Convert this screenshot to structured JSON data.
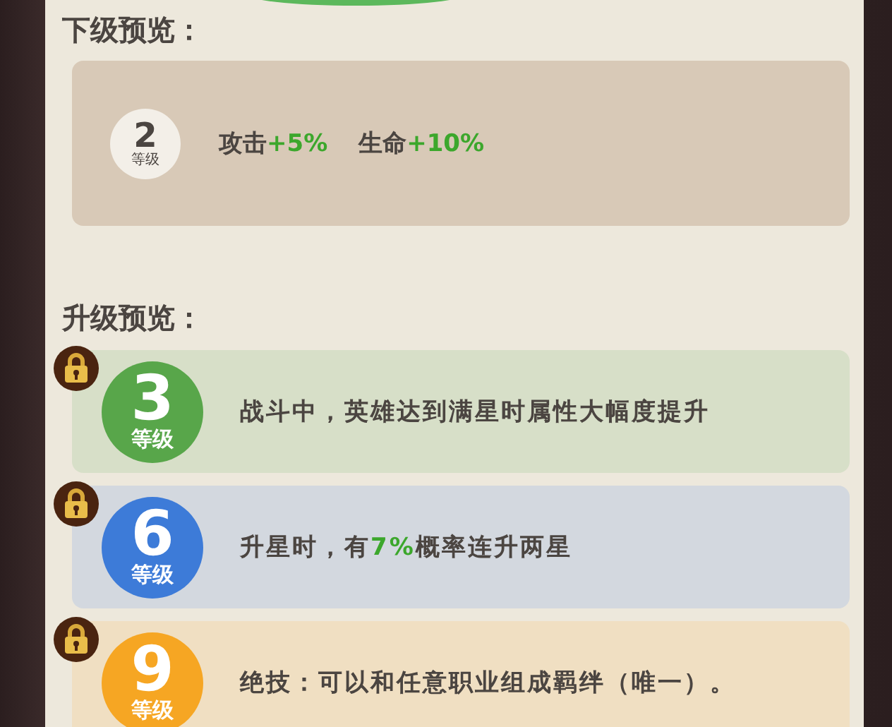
{
  "next_preview": {
    "title": "下级预览：",
    "level": {
      "number": "2",
      "label": "等级"
    },
    "stats": [
      {
        "name": "攻击",
        "value": "+5%"
      },
      {
        "name": "生命",
        "value": "+10%"
      }
    ]
  },
  "upgrade_preview": {
    "title": "升级预览：",
    "items": [
      {
        "number": "3",
        "label": "等级",
        "color": "#58a64a",
        "locked": true,
        "description": "战斗中，英雄达到满星时属性大幅度提升"
      },
      {
        "number": "6",
        "label": "等级",
        "color": "#3d7bd8",
        "locked": true,
        "description": "升星时，有**7%**概率连升两星"
      },
      {
        "number": "9",
        "label": "等级",
        "color": "#f6a623",
        "locked": true,
        "description": "绝技：可以和任意职业组成羁绊（唯一）。"
      }
    ]
  }
}
